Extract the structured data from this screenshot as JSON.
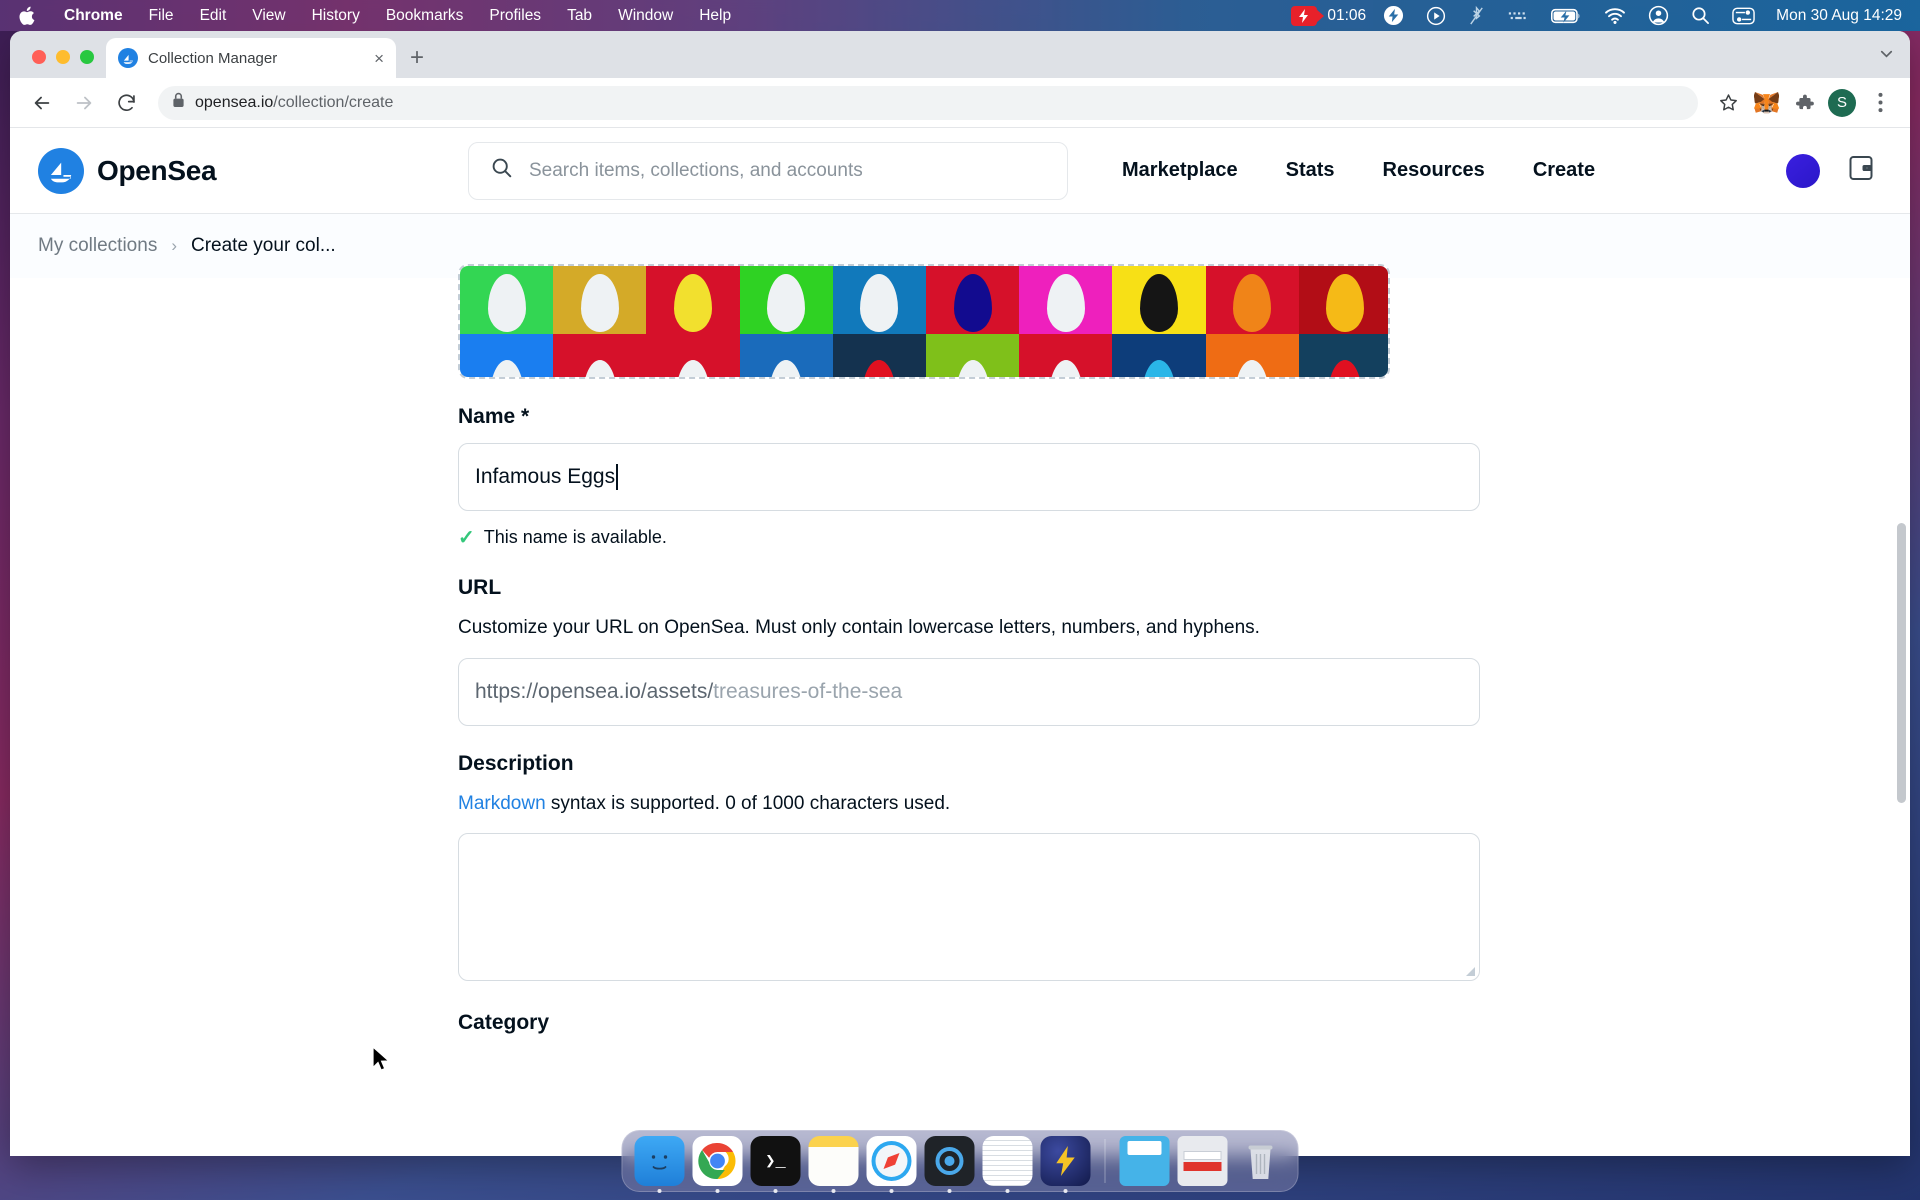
{
  "menubar": {
    "apple_icon": "apple-logo-icon",
    "items": [
      {
        "label": "Chrome",
        "bold": true
      },
      {
        "label": "File",
        "bold": false
      },
      {
        "label": "Edit",
        "bold": false
      },
      {
        "label": "View",
        "bold": false
      },
      {
        "label": "History",
        "bold": false
      },
      {
        "label": "Bookmarks",
        "bold": false
      },
      {
        "label": "Profiles",
        "bold": false
      },
      {
        "label": "Tab",
        "bold": false
      },
      {
        "label": "Window",
        "bold": false
      },
      {
        "label": "Help",
        "bold": false
      }
    ],
    "recording_time": "01:06",
    "status_icons": [
      "screen-record-icon",
      "bolt-icon",
      "play-circle-icon",
      "bluetooth-off-icon",
      "keyboard-brightness-icon",
      "battery-charging-icon",
      "wifi-icon",
      "user-account-icon",
      "search-icon",
      "control-center-icon"
    ],
    "datetime": "Mon 30 Aug  14:29"
  },
  "browser": {
    "tab": {
      "title": "Collection Manager",
      "favicon": "opensea-sail-icon",
      "close_label": "×"
    },
    "new_tab_label": "+",
    "tabstrip_right_icon": "chevron-down-icon",
    "toolbar": {
      "back_icon": "arrow-left-icon",
      "forward_icon": "arrow-right-icon",
      "reload_icon": "reload-icon",
      "lock_icon": "lock-icon",
      "url_domain": "opensea.io",
      "url_path": "/collection/create",
      "bookmark_icon": "star-icon",
      "metamask_icon": "metamask-fox-icon",
      "extensions_icon": "puzzle-piece-icon",
      "profile_initial": "S",
      "menu_icon": "three-dots-menu-icon"
    }
  },
  "site": {
    "brand": {
      "name": "OpenSea",
      "logo": "opensea-sailboat-logo-icon",
      "color": "#2081e2"
    },
    "search": {
      "placeholder": "Search items, collections, and accounts",
      "icon": "search-icon"
    },
    "nav": [
      {
        "label": "Marketplace"
      },
      {
        "label": "Stats"
      },
      {
        "label": "Resources"
      },
      {
        "label": "Create"
      }
    ],
    "account_avatar": "account-avatar",
    "wallet_icon": "wallet-icon",
    "breadcrumb": {
      "parent": "My collections",
      "separator": "›",
      "current": "Create your col..."
    }
  },
  "form": {
    "featured_images": {
      "name": "collection-image-preview",
      "row1": [
        {
          "bg": "#33d653",
          "egg": "#eef2f4"
        },
        {
          "bg": "#d4aa28",
          "egg": "#eef2f4"
        },
        {
          "bg": "#d6112a",
          "egg": "#f2e02e"
        },
        {
          "bg": "#2fd223",
          "egg": "#eef2f4"
        },
        {
          "bg": "#1179bb",
          "egg": "#eef2f4"
        },
        {
          "bg": "#d6112a",
          "egg": "#120b8f"
        },
        {
          "bg": "#ee20bd",
          "egg": "#eef2f4"
        },
        {
          "bg": "#f7e016",
          "egg": "#151515"
        },
        {
          "bg": "#d6112a",
          "egg": "#f08418"
        },
        {
          "bg": "#b20d16",
          "egg": "#f5ba17"
        }
      ],
      "row2": [
        {
          "bg": "#1a7ef0",
          "egg": "#eef2f4"
        },
        {
          "bg": "#d6112a",
          "egg": "#eef2f4"
        },
        {
          "bg": "#d6112a",
          "egg": "#eef2f4"
        },
        {
          "bg": "#1a6bbb",
          "egg": "#eef2f4"
        },
        {
          "bg": "#14324f",
          "egg": "#e01020"
        },
        {
          "bg": "#7fc01a",
          "egg": "#eef2f4"
        },
        {
          "bg": "#d6112a",
          "egg": "#eef2f4"
        },
        {
          "bg": "#0d3d7a",
          "egg": "#2ab6e8"
        },
        {
          "bg": "#ef6c14",
          "egg": "#eef2f4"
        },
        {
          "bg": "#13405e",
          "egg": "#e01020"
        }
      ]
    },
    "name": {
      "label": "Name *",
      "value": "Infamous Eggs",
      "availability": "This name is available.",
      "availability_icon": "check-icon",
      "availability_color": "#34c77b"
    },
    "url": {
      "label": "URL",
      "help": "Customize your URL on OpenSea. Must only contain lowercase letters, numbers, and hyphens.",
      "prefix": "https://opensea.io/assets/",
      "placeholder_suffix": "treasures-of-the-sea"
    },
    "description": {
      "label": "Description",
      "help_link": "Markdown",
      "help_text": " syntax is supported. 0 of 1000 characters used.",
      "value": ""
    },
    "category": {
      "label": "Category"
    }
  },
  "dock": {
    "items": [
      {
        "name": "finder",
        "glyph": "☺"
      },
      {
        "name": "chrome",
        "glyph": "◉"
      },
      {
        "name": "terminal",
        "glyph": "❯_"
      },
      {
        "name": "notes",
        "glyph": ""
      },
      {
        "name": "safari",
        "glyph": "✦"
      },
      {
        "name": "quicktime",
        "glyph": "●"
      },
      {
        "name": "textedit",
        "glyph": "✎"
      },
      {
        "name": "thunder-app",
        "glyph": "⚡"
      },
      {
        "name": "downloads-folder",
        "glyph": ""
      },
      {
        "name": "stack-widget",
        "glyph": ""
      },
      {
        "name": "trash",
        "glyph": ""
      }
    ]
  }
}
